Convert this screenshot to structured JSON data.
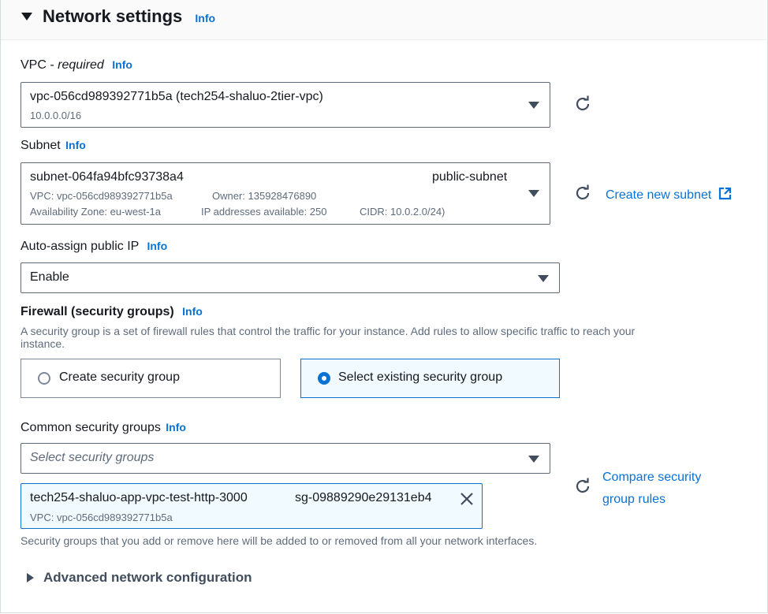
{
  "section": {
    "title": "Network settings",
    "info": "Info"
  },
  "vpc": {
    "label_main": "VPC - ",
    "label_required": "required",
    "info": "Info",
    "value": "vpc-056cd989392771b5a (tech254-shaluo-2tier-vpc)",
    "cidr": "10.0.0.0/16"
  },
  "subnet": {
    "label": "Subnet",
    "info": "Info",
    "value": "subnet-064fa94bfc93738a4",
    "name": "public-subnet",
    "vpc": "VPC: vpc-056cd989392771b5a",
    "owner": "Owner: 135928476890",
    "az": "Availability Zone: eu-west-1a",
    "ips": "IP addresses available: 250",
    "cidr": "CIDR: 10.0.2.0/24)",
    "create_link": "Create new subnet"
  },
  "public_ip": {
    "label": "Auto-assign public IP",
    "info": "Info",
    "value": "Enable"
  },
  "firewall": {
    "label": "Firewall (security groups)",
    "info": "Info",
    "description": "A security group is a set of firewall rules that control the traffic for your instance. Add rules to allow specific traffic to reach your",
    "description2": "instance.",
    "option_create": "Create security group",
    "option_existing": "Select existing security group",
    "selected": "existing"
  },
  "common_sg": {
    "label": "Common security groups",
    "info": "Info",
    "placeholder": "Select security groups",
    "token_name": "tech254-shaluo-app-vpc-test-http-3000",
    "token_id": "sg-09889290e29131eb4",
    "token_vpc": "VPC: vpc-056cd989392771b5a",
    "compare_link_1": "Compare security",
    "compare_link_2": "group rules",
    "help": "Security groups that you add or remove here will be added to or removed from all your network interfaces."
  },
  "advanced": {
    "label": "Advanced network configuration"
  },
  "colors": {
    "accent": "#0972d3",
    "text": "#16191f",
    "muted": "#5f6b7a"
  },
  "icons": [
    "caret-down-icon",
    "refresh-icon",
    "external-link-icon",
    "close-icon",
    "caret-right-icon"
  ]
}
